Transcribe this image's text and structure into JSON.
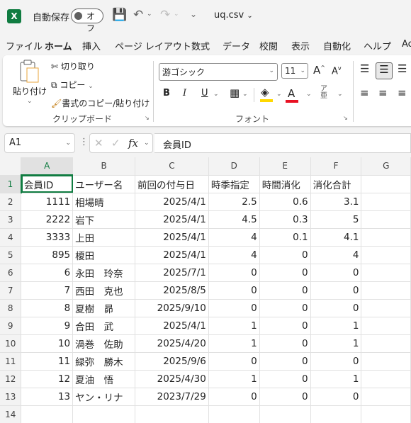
{
  "titlebar": {
    "app_icon": "X",
    "autosave_label": "自動保存",
    "autosave_state": "オフ",
    "filename": "uq.csv",
    "icons": [
      "save-icon",
      "undo-icon",
      "redo-icon",
      "customize-icon"
    ]
  },
  "ribbon_tabs": [
    "ファイル",
    "ホーム",
    "挿入",
    "ページ レイアウト",
    "数式",
    "データ",
    "校閲",
    "表示",
    "自動化",
    "ヘルプ",
    "Ac"
  ],
  "active_tab": "ホーム",
  "clipboard": {
    "paste": "貼り付け",
    "cut": "切り取り",
    "copy": "コピー",
    "format_painter": "書式のコピー/貼り付け",
    "group_label": "クリップボード"
  },
  "font": {
    "family": "游ゴシック",
    "size": "11",
    "group_label": "フォント",
    "bold": "B",
    "italic": "I",
    "underline": "U",
    "font_color": "#e81123",
    "fill_color": "#ffd800"
  },
  "formula_bar": {
    "name_box": "A1",
    "formula": "会員ID"
  },
  "sheet": {
    "columns": [
      "A",
      "B",
      "C",
      "D",
      "E",
      "F",
      "G"
    ],
    "rows": [
      [
        "会員ID",
        "ユーザー名",
        "前回の付与日",
        "時季指定",
        "時間消化",
        "消化合計",
        ""
      ],
      [
        "1111",
        "相場晴",
        "2025/4/1",
        "2.5",
        "0.6",
        "3.1",
        ""
      ],
      [
        "2222",
        "岩下",
        "2025/4/1",
        "4.5",
        "0.3",
        "5",
        ""
      ],
      [
        "3333",
        "上田",
        "2025/4/1",
        "4",
        "0.1",
        "4.1",
        ""
      ],
      [
        "895",
        "榎田",
        "2025/4/1",
        "4",
        "0",
        "4",
        ""
      ],
      [
        "6",
        "永田　玲奈",
        "2025/7/1",
        "0",
        "0",
        "0",
        ""
      ],
      [
        "7",
        "西田　克也",
        "2025/8/5",
        "0",
        "0",
        "0",
        ""
      ],
      [
        "8",
        "夏樹　昴",
        "2025/9/10",
        "0",
        "0",
        "0",
        ""
      ],
      [
        "9",
        "合田　武",
        "2025/4/1",
        "1",
        "0",
        "1",
        ""
      ],
      [
        "10",
        "渦巻　佐助",
        "2025/4/20",
        "1",
        "0",
        "1",
        ""
      ],
      [
        "11",
        "緑弥　勝木",
        "2025/9/6",
        "0",
        "0",
        "0",
        ""
      ],
      [
        "12",
        "夏油　悟",
        "2025/4/30",
        "1",
        "0",
        "1",
        ""
      ],
      [
        "13",
        "ヤン・リナ",
        "2023/7/29",
        "0",
        "0",
        "0",
        ""
      ],
      [
        "",
        "",
        "",
        "",
        "",
        "",
        ""
      ]
    ]
  }
}
